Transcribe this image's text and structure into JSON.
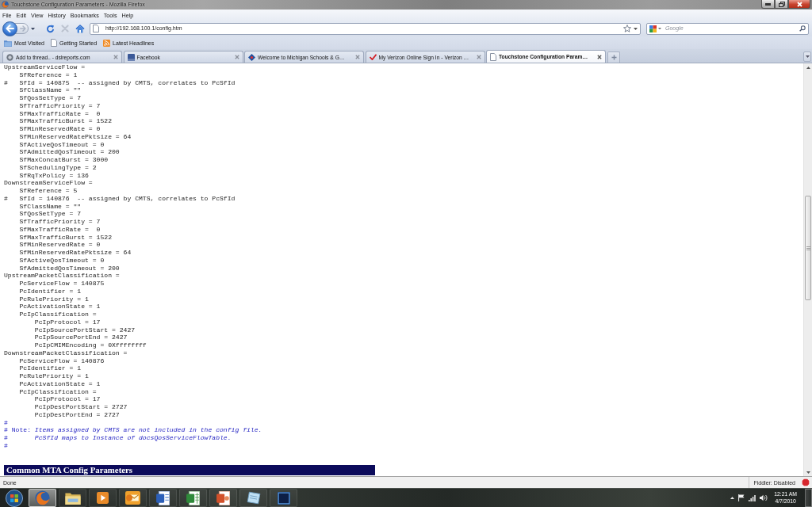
{
  "window": {
    "title": "Touchstone Configuration Parameters - Mozilla Firefox"
  },
  "menu_bar": [
    {
      "label": "File"
    },
    {
      "label": "Edit"
    },
    {
      "label": "View"
    },
    {
      "label": "History"
    },
    {
      "label": "Bookmarks"
    },
    {
      "label": "Tools"
    },
    {
      "label": "Help"
    }
  ],
  "nav_buttons": [
    {
      "kind": "back",
      "disabled": false
    },
    {
      "kind": "forward",
      "disabled": true
    },
    {
      "kind": "history",
      "disabled": false
    },
    {
      "kind": "reload",
      "disabled": false
    },
    {
      "kind": "stop",
      "disabled": true
    },
    {
      "kind": "home",
      "disabled": false
    }
  ],
  "address_bar": {
    "value": "http://192.168.100.1/config.htm"
  },
  "search_field": {
    "placeholder": "Google"
  },
  "bookmarks": [
    {
      "kind": "folder",
      "label": "Most Visited"
    },
    {
      "kind": "page",
      "label": "Getting Started"
    },
    {
      "kind": "feed",
      "label": "Latest Headlines"
    }
  ],
  "tabs": [
    {
      "kind": "circle",
      "label": "Add to thread.. - dslreports.com",
      "selected": false
    },
    {
      "kind": "square",
      "label": "Facebook",
      "selected": false
    },
    {
      "kind": "diamond",
      "label": "Welcome to Michigan Schools & G…",
      "selected": false
    },
    {
      "kind": "check",
      "label": "My Verizon Online Sign In - Verizon …",
      "selected": false
    },
    {
      "kind": "page",
      "label": "Touchstone Configuration Param…",
      "selected": true
    }
  ],
  "page": {
    "listing": [
      {
        "text": "UpstreamServiceFlow =",
        "children": [
          {
            "text": "SfReference = 1"
          },
          {
            "marker": "#",
            "text": "SfId = 140875  -- assigned by CMTS, correlates to PcSfId"
          },
          {
            "text": "SfClassName = \"\""
          },
          {
            "text": "SfQosSetType = 7"
          },
          {
            "text": "SfTrafficPriority = 7"
          },
          {
            "text": "SfMaxTrafficRate =  0"
          },
          {
            "text": "SfMaxTrafficBurst = 1522"
          },
          {
            "text": "SfMinReservedRate = 0"
          },
          {
            "text": "SfMinReservedRatePktsize = 64"
          },
          {
            "text": "SfActiveQosTimeout = 0"
          },
          {
            "text": "SfAdmittedQosTimeout = 200"
          },
          {
            "text": "SfMaxConcatBurst = 3000"
          },
          {
            "text": "SfSchedulingType = 2"
          },
          {
            "text": "SfRqTxPolicy = 136"
          }
        ]
      },
      {
        "text": "DownstreamServiceFlow =",
        "children": [
          {
            "text": "SfReference = 5"
          },
          {
            "marker": "#",
            "text": "SfId = 140876  -- assigned by CMTS, correlates to PcSfId"
          },
          {
            "text": "SfClassName = \"\""
          },
          {
            "text": "SfQosSetType = 7"
          },
          {
            "text": "SfTrafficPriority = 7"
          },
          {
            "text": "SfMaxTrafficRate =  0"
          },
          {
            "text": "SfMaxTrafficBurst = 1522"
          },
          {
            "text": "SfMinReservedRate = 0"
          },
          {
            "text": "SfMinReservedRatePktsize = 64"
          },
          {
            "text": "SfActiveQosTimeout = 0"
          },
          {
            "text": "SfAdmittedQosTimeout = 200"
          }
        ]
      },
      {
        "text": "UpstreamPacketClassification =",
        "children": [
          {
            "text": "PcServiceFlow = 140875"
          },
          {
            "text": "PcIdentifier = 1"
          },
          {
            "text": "PcRulePriority = 1"
          },
          {
            "text": "PcActivationState = 1"
          },
          {
            "text": "PcIpClassification =",
            "children": [
              {
                "text": "PcIpProtocol = 17"
              },
              {
                "text": "PcIpSourcePortStart = 2427"
              },
              {
                "text": "PcIpSourcePortEnd = 2427"
              },
              {
                "text": "PcIpCMIMEncoding = 0Xffffffff"
              }
            ]
          }
        ]
      },
      {
        "text": "DownstreamPacketClassification =",
        "children": [
          {
            "text": "PcServiceFlow = 140876"
          },
          {
            "text": "PcIdentifier = 1"
          },
          {
            "text": "PcRulePriority = 1"
          },
          {
            "text": "PcActivationState = 1"
          },
          {
            "text": "PcIpClassification =",
            "children": [
              {
                "text": "PcIpProtocol = 17"
              },
              {
                "text": "PcIpDestPortStart = 2727"
              },
              {
                "text": "PcIpDestPortEnd = 2727"
              }
            ]
          }
        ]
      }
    ],
    "notes": [
      "#",
      "# Note: *Items assigned by CMTS are not included in the config file.*",
      "#       *PcSfId maps to Instance of docsQosServiceFlowTable.*",
      "#"
    ],
    "section_heading": "Common MTA Config Parameters"
  },
  "status_bar": {
    "text": "Done",
    "addon": "Fiddler: Disabled"
  },
  "taskbar": {
    "apps": [
      {
        "kind": "browser",
        "selected": true
      },
      {
        "kind": "folder",
        "selected": false
      },
      {
        "kind": "media",
        "selected": false
      },
      {
        "kind": "mail",
        "selected": false
      },
      {
        "kind": "document",
        "selected": false
      },
      {
        "kind": "spreadsheet",
        "selected": false
      },
      {
        "kind": "slides",
        "selected": false
      },
      {
        "kind": "notes",
        "selected": false
      },
      {
        "kind": "image-editor",
        "selected": false
      }
    ],
    "clock": {
      "time": "12:21 AM",
      "date": "4/7/2010"
    }
  }
}
